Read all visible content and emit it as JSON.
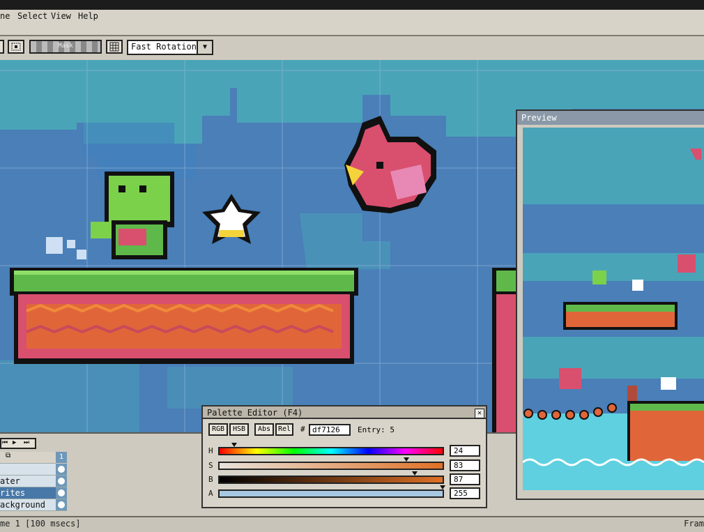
{
  "menu": [
    "ne",
    "Select",
    "View",
    "Help"
  ],
  "toolbar": {
    "mask_label": "Mask",
    "rotation_select": "Fast Rotation"
  },
  "timeline": {
    "layers": [
      {
        "name": "",
        "selected": false
      },
      {
        "name": "ater",
        "selected": false
      },
      {
        "name": "rites",
        "selected": true
      },
      {
        "name": "ackground",
        "selected": false
      }
    ],
    "frame_number": "1"
  },
  "palette_editor": {
    "title": "Palette Editor (F4)",
    "buttons": [
      "RGB",
      "HSB",
      "Abs",
      "Rel"
    ],
    "hex_prefix": "#",
    "hex": "df7126",
    "entry_label": "Entry: 5",
    "sliders": [
      {
        "label": "H",
        "value": "24"
      },
      {
        "label": "S",
        "value": "83"
      },
      {
        "label": "B",
        "value": "87"
      },
      {
        "label": "A",
        "value": "255"
      }
    ]
  },
  "preview": {
    "title": "Preview"
  },
  "status": {
    "left": "me 1 [100 msecs]",
    "right": "Fram"
  },
  "colors": {
    "sky": "#4a7fb8",
    "cloud": "#4aa4b8",
    "grass": "#5fb94a",
    "brick": "#e0663a",
    "pink": "#d94f6e",
    "frog": "#7cd14a"
  }
}
